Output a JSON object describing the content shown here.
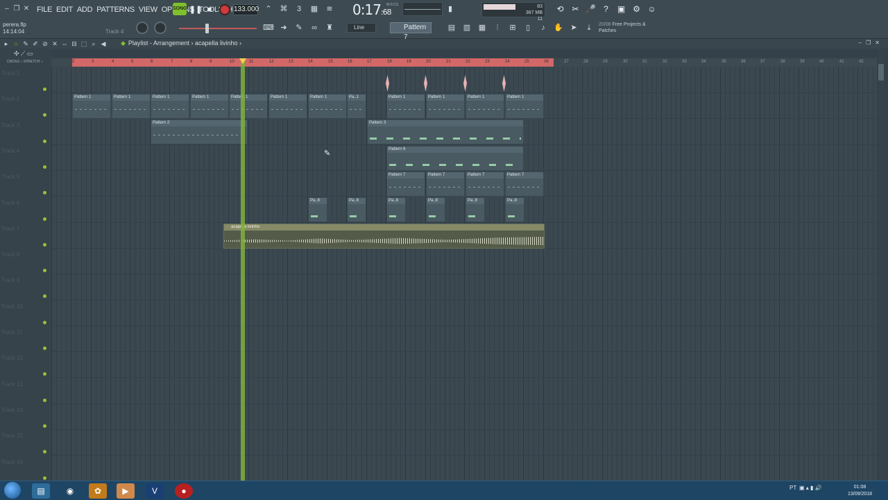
{
  "window": {
    "minimize": "‒",
    "restore": "❐",
    "close": "✕"
  },
  "menu": [
    "FILE",
    "EDIT",
    "ADD",
    "PATTERNS",
    "VIEW",
    "OPTIONS",
    "TOOLS",
    "HELP"
  ],
  "project": {
    "name": "perera.flp",
    "time": "14:14:04",
    "hint": "Track 4"
  },
  "transport": {
    "song_label": "SONG",
    "play": "❚❚",
    "stop": "■",
    "tempo": "133.000"
  },
  "time_display": {
    "main": "0:17",
    "sub": "68",
    "unit": "M:S:CS"
  },
  "memory": {
    "cpu": "83",
    "ram": "367 MB",
    "poly": "11"
  },
  "snap": {
    "value": "Line"
  },
  "pattern_selector": {
    "value": "Pattern 7"
  },
  "news": {
    "line1": "20/08",
    "title": "Free Projects &",
    "line2": "Patches"
  },
  "playlist": {
    "title": "Playlist - Arrangement",
    "clip": "acapella livinho",
    "cross_label": "CROSS",
    "stretch_label": "STRETCH"
  },
  "ruler": [
    "2",
    "3",
    "4",
    "5",
    "6",
    "7",
    "8",
    "9",
    "10",
    "11",
    "12",
    "13",
    "14",
    "15",
    "16",
    "17",
    "18",
    "19",
    "20",
    "21",
    "22",
    "23",
    "24",
    "25",
    "26",
    "27",
    "28",
    "29",
    "30",
    "31",
    "32",
    "33",
    "34",
    "35",
    "36",
    "37",
    "38",
    "39",
    "40",
    "41",
    "42"
  ],
  "tracks": [
    "Track 1",
    "Track 2",
    "Track 3",
    "Track 4",
    "Track 5",
    "Track 6",
    "Track 7",
    "Track 8",
    "Track 9",
    "Track 10",
    "Track 11",
    "Track 12",
    "Track 13",
    "Track 14",
    "Track 15",
    "Track 16"
  ],
  "clips": {
    "p1": "Pattern 1",
    "p1_short": "Pa..1",
    "p2": "Pattern 2",
    "p3": "Pattern 3",
    "p6": "Pattern 6",
    "p7": "Pattern 7",
    "p8_short": "Pa..8",
    "audio": "acapella livinho"
  },
  "taskbar": {
    "lang": "PT",
    "time": "01:08",
    "date": "13/09/2018"
  },
  "colors": {
    "accent": "#7fbf2e",
    "loop": "#d26868",
    "playhead": "#7fb13d",
    "record": "#d13a3a"
  }
}
